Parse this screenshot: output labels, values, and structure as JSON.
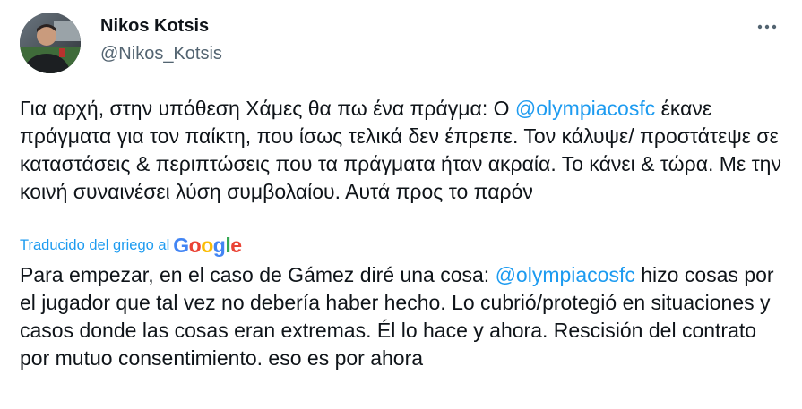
{
  "author": {
    "name": "Nikos Kotsis",
    "handle": "@Nikos_Kotsis"
  },
  "more_icon": "more-horizontal-icon",
  "tweet": {
    "original": {
      "before_mention": "Για αρχή, στην υπόθεση Χάμες θα πω ένα πράγμα: Ο ",
      "mention": "@olympiacosfc",
      "after_mention": " έκανε πράγματα για τον παίκτη, που ίσως τελικά δεν έπρεπε. Τον κάλυψε/ προστάτεψε σε καταστάσεις & περιπτώσεις που τα πράγματα ήταν ακραία. Το κάνει & τώρα. Με την κοινή συναινέσει λύση συμβολαίου. Αυτά προς το παρόν"
    },
    "translation_label": "Traducido del griego al",
    "translation_provider": {
      "letters": [
        "G",
        "o",
        "o",
        "g",
        "l",
        "e"
      ],
      "colors": [
        "#4285f4",
        "#ea4335",
        "#fbbc05",
        "#4285f4",
        "#34a853",
        "#ea4335"
      ]
    },
    "translated": {
      "before_mention": "Para empezar, en el caso de Gámez diré una cosa: ",
      "mention": "@olympiacosfc",
      "after_mention": " hizo cosas por el jugador que tal vez no debería haber hecho. Lo cubrió/protegió en situaciones y casos donde las cosas eran extremas. Él lo hace y ahora. Rescisión del contrato por mutuo consentimiento. eso es por ahora"
    }
  },
  "colors": {
    "link": "#1d9bf0",
    "text": "#0f1419",
    "secondary": "#536471"
  }
}
